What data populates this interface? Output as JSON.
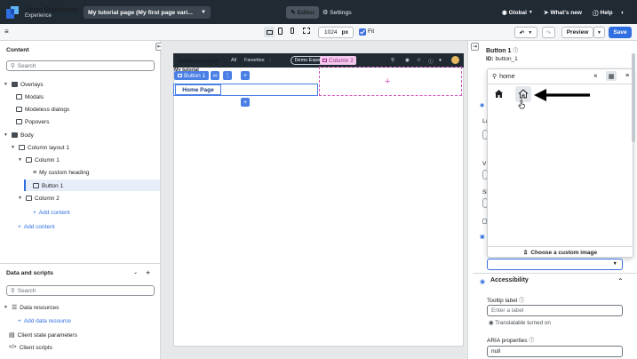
{
  "app": {
    "name": "Demo Experience",
    "subtitle": "Experience",
    "page_select": "My tutorial page (My first page vari...",
    "editor_tab": "Editor",
    "settings_tab": "Settings",
    "scope": "Global",
    "whats_new": "What's new",
    "help": "Help",
    "accent": "#2f6ee0"
  },
  "toolbar": {
    "width_value": "1024",
    "width_unit": "px",
    "fit_label": "Fit",
    "preview_label": "Preview",
    "save_label": "Save"
  },
  "left": {
    "content_title": "Content",
    "search_placeholder": "Search",
    "tree": {
      "overlays": "Overlays",
      "modals": "Modals",
      "modeless": "Modeless dialogs",
      "popovers": "Popovers",
      "body": "Body",
      "column_layout": "Column layout 1",
      "column1": "Column 1",
      "heading": "My custom heading",
      "button1": "Button 1",
      "column2": "Column 2",
      "add_content_1": "Add content",
      "add_content_2": "Add content"
    },
    "data_title": "Data and scripts",
    "data_search_placeholder": "Search",
    "data_resources": "Data resources",
    "add_data_resource": "Add data resource",
    "client_state": "Client state parameters",
    "client_scripts": "Client scripts"
  },
  "canvas": {
    "logo": "servicenow",
    "nav_all": "All",
    "nav_favorites": "Favorites",
    "pill": "Demo Experie",
    "button1_tag": "Button 1",
    "home_button": "Home Page",
    "column2_tag": "Column 2",
    "my_tutorial": "My tutorial"
  },
  "right": {
    "title": "Button 1",
    "id_label": "ID:",
    "id_value": "button_1",
    "icon_search_value": "home",
    "custom_image": "Choose a custom image",
    "accessibility": "Accessibility",
    "tooltip_label": "Tooltip label",
    "tooltip_placeholder": "Enter a label",
    "translatable": "Translatable turned on",
    "aria_label": "ARIA properties",
    "aria_value": "null",
    "partial_labels": [
      "La",
      "V",
      "Si"
    ]
  }
}
